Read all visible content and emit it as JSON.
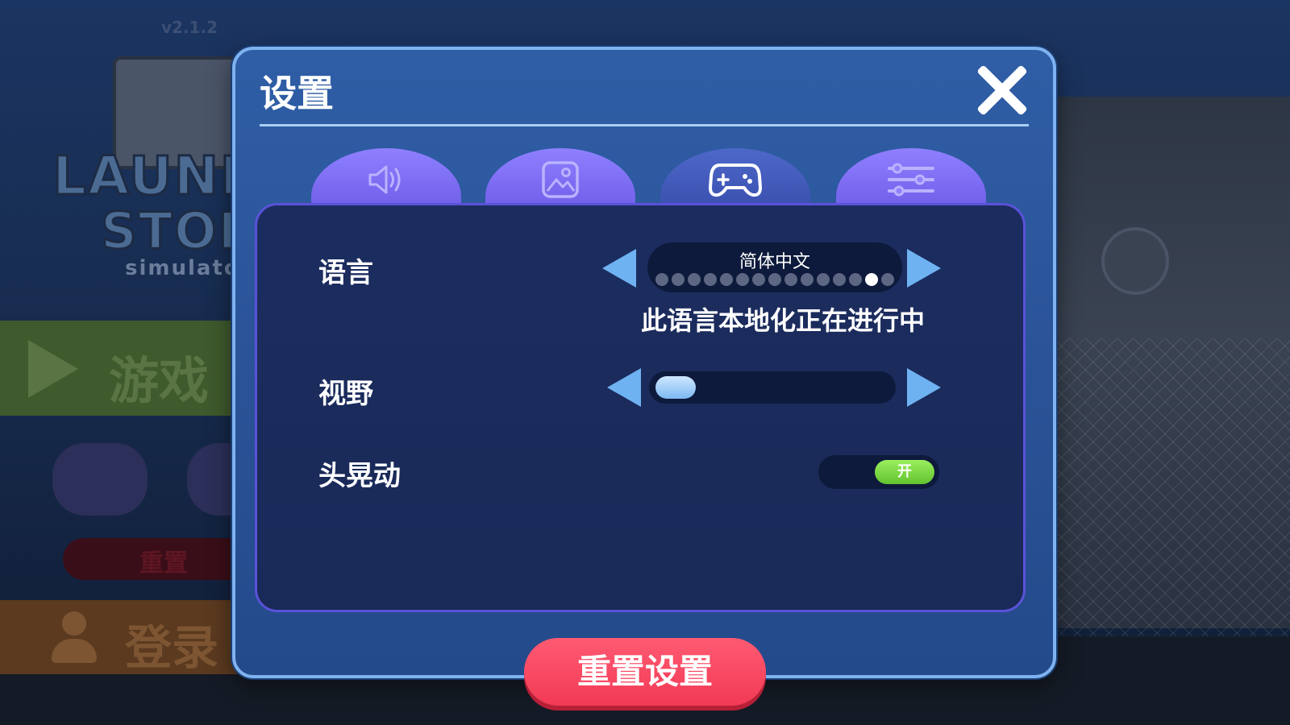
{
  "background": {
    "version": "v2.1.2",
    "logo": {
      "line1": "LAUNDRY",
      "line2": "STORE",
      "line3": "simulator"
    },
    "menu": {
      "play_label": "游戏",
      "reset_label": "重置",
      "login_label": "登录"
    }
  },
  "dialog": {
    "title": "设置",
    "tabs": [
      {
        "icon": "speaker-icon",
        "active": false
      },
      {
        "icon": "image-icon",
        "active": false
      },
      {
        "icon": "gamepad-icon",
        "active": true
      },
      {
        "icon": "sliders-icon",
        "active": false
      }
    ],
    "settings": {
      "language": {
        "label": "语言",
        "value": "简体中文",
        "note": "此语言本地化正在进行中",
        "option_count": 15,
        "selected_index": 13
      },
      "fov": {
        "label": "视野",
        "level": 0.0
      },
      "head_bob": {
        "label": "头晃动",
        "state": "开",
        "enabled": true
      }
    },
    "reset_button": "重置设置"
  },
  "colors": {
    "dialog_border": "#7fb2f0",
    "tab": "#8f80ff",
    "arrow": "#6fb2f2",
    "toggle_on": "#6fd13a",
    "reset": "#f5435d"
  }
}
